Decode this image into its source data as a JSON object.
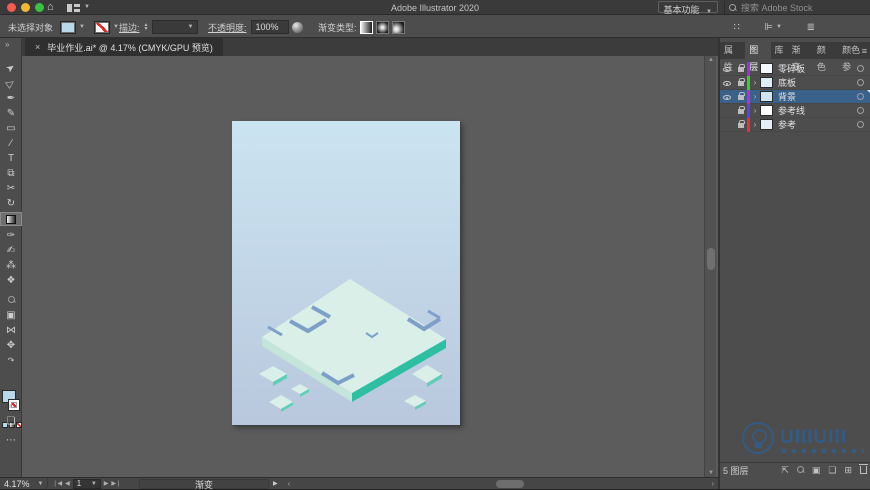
{
  "colors": {
    "selection-blue": "#39618a",
    "fill-swatch": "#b9d9ea",
    "artboard-top": "#cbe4f1",
    "artboard-bottom": "#b9c8dd",
    "plate-top": "#d9efe7",
    "plate-left": "#c3e5da",
    "plate-right": "#2ebfa3",
    "tile-edge": "#5fceb6",
    "chevron": "#7da0c9",
    "watermark": "#2d5f92"
  },
  "titlebar": {
    "title": "Adobe Illustrator 2020",
    "workspace": "基本功能",
    "search_placeholder": "搜索 Adobe Stock"
  },
  "controlbar": {
    "selection_status": "未选择对象",
    "stroke_label": "描边:",
    "opacity_label": "不透明度:",
    "opacity_value": "100%",
    "gradient_type_label": "渐变类型:"
  },
  "document_tab": {
    "close": "×",
    "title": "毕业作业.ai* @ 4.17% (CMYK/GPU 预览)"
  },
  "toolbar": {
    "tools": [
      {
        "name": "selection-tool",
        "glyph": "➤"
      },
      {
        "name": "direct-selection-tool",
        "glyph": "▷"
      },
      {
        "name": "pen-tool",
        "glyph": "✒"
      },
      {
        "name": "curvature-tool",
        "glyph": "✎"
      },
      {
        "name": "rectangle-tool",
        "glyph": "▭"
      },
      {
        "name": "line-segment-tool",
        "glyph": "∕"
      },
      {
        "name": "type-tool",
        "glyph": "T"
      },
      {
        "name": "free-transform-tool",
        "glyph": "⧉"
      },
      {
        "name": "scissors-tool",
        "glyph": "✂"
      },
      {
        "name": "rotate-tool",
        "glyph": "↻"
      },
      {
        "name": "gradient-tool",
        "glyph": ""
      },
      {
        "name": "eyedropper-tool",
        "glyph": "✑"
      },
      {
        "name": "paintbrush-tool",
        "glyph": "✍"
      },
      {
        "name": "symbol-sprayer-tool",
        "glyph": "⁂"
      },
      {
        "name": "blend-tool",
        "glyph": "❖"
      },
      {
        "name": "zoom-tool",
        "glyph": ""
      },
      {
        "name": "artboard-tool",
        "glyph": "▣"
      },
      {
        "name": "width-tool",
        "glyph": "⋈"
      },
      {
        "name": "puppet-warp-tool",
        "glyph": "✥"
      },
      {
        "name": "swap-fill-stroke",
        "glyph": "↷"
      },
      {
        "name": "draw-mode",
        "glyph": "◐"
      },
      {
        "name": "screen-mode",
        "glyph": "❏"
      },
      {
        "name": "more-tools",
        "glyph": "⋯"
      }
    ]
  },
  "statusbar": {
    "zoom": "4.17%",
    "page": "1",
    "tool_indicator": "渐变"
  },
  "panel": {
    "tabs": [
      "属性",
      "图层",
      "库",
      "渐变",
      "颜色",
      "颜色参"
    ],
    "active_tab": "图层",
    "layers": [
      {
        "name": "零碎板",
        "color": "#9b30e0",
        "thumb": "#f2f8fb",
        "visible": true,
        "locked": true,
        "selected": false
      },
      {
        "name": "底板",
        "color": "#2ed32e",
        "thumb": "#dbeef6",
        "visible": true,
        "locked": true,
        "selected": false
      },
      {
        "name": "背景",
        "color": "#b82fd8",
        "thumb": "#cfe6f2",
        "visible": true,
        "locked": true,
        "selected": true
      },
      {
        "name": "参考线",
        "color": "#5a43e8",
        "thumb": "#ffffff",
        "visible": false,
        "locked": true,
        "selected": false
      },
      {
        "name": "参考",
        "color": "#e8303a",
        "thumb": "#e6edf4",
        "visible": false,
        "locked": true,
        "selected": false
      }
    ],
    "footer_count": "5 图层"
  },
  "watermark": {
    "text": "UIIIUIII"
  }
}
